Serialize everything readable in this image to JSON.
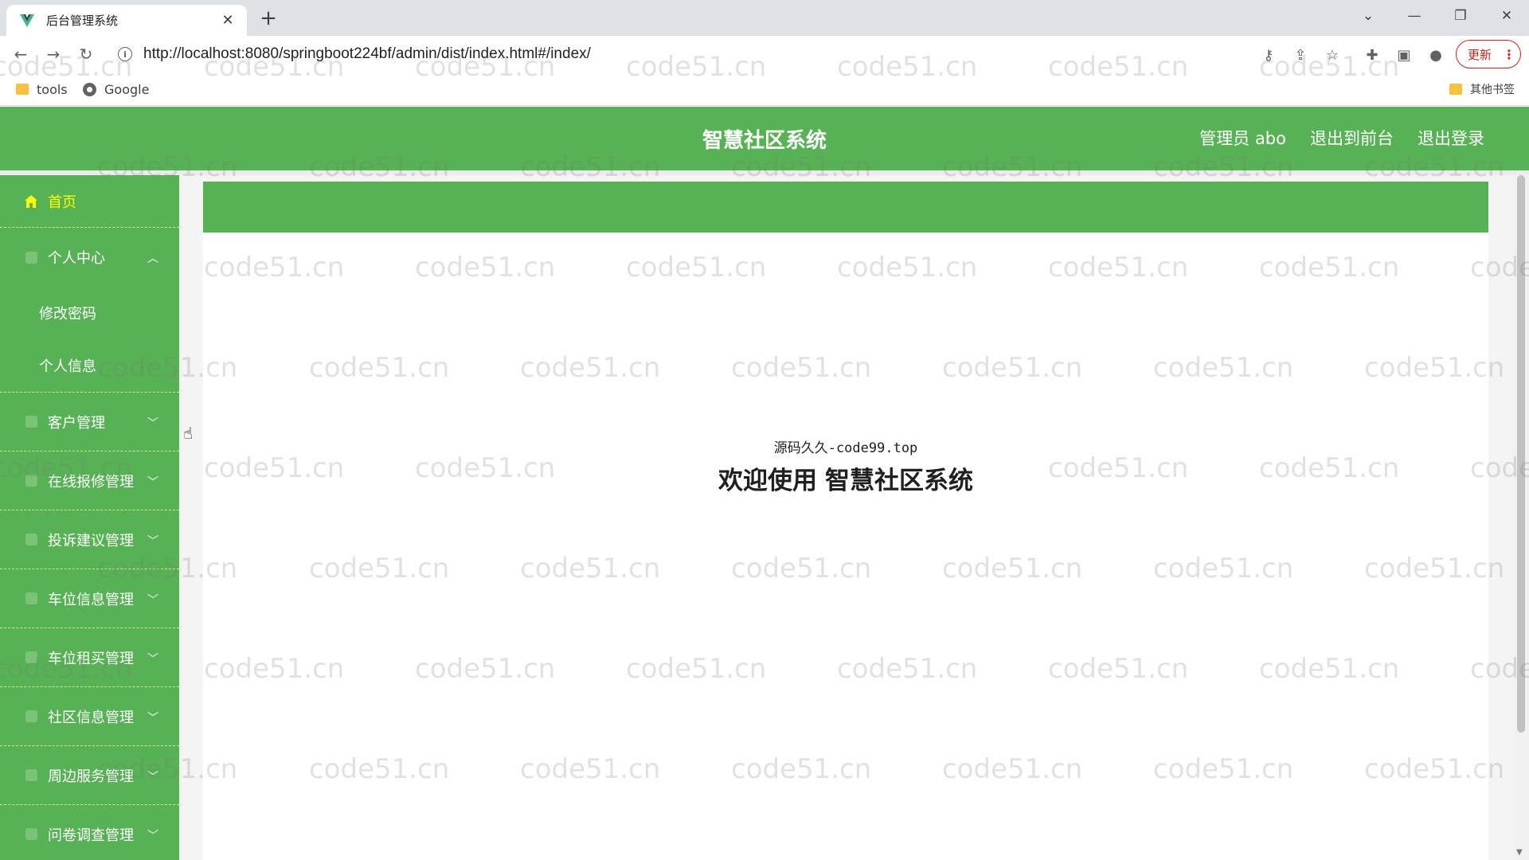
{
  "browser": {
    "tab_title": "后台管理系统",
    "tab_close": "✕",
    "new_tab": "+",
    "url": "http://localhost:8080/springboot224bf/admin/dist/index.html#/index/",
    "update_label": "更新",
    "bookmarks": [
      {
        "label": "tools",
        "icon": "folder-icon"
      },
      {
        "label": "Google",
        "icon": "globe-icon"
      }
    ],
    "other_bookmarks": "其他书签"
  },
  "app": {
    "title": "智慧社区系统",
    "header_links": [
      "管理员 abo",
      "退出到前台",
      "退出登录"
    ],
    "colors": {
      "primary": "#56b254",
      "active_menu": "#ffff00"
    }
  },
  "sidebar": {
    "home": "首页",
    "personal": {
      "label": "个人中心",
      "children": [
        "修改密码",
        "个人信息"
      ]
    },
    "items": [
      "客户管理",
      "在线报修管理",
      "投诉建议管理",
      "车位信息管理",
      "车位租买管理",
      "社区信息管理",
      "周边服务管理",
      "问卷调查管理"
    ]
  },
  "main": {
    "credit": "源码久久-code99.top",
    "welcome_prefix": "欢迎使用",
    "welcome_system": "智慧社区系统"
  },
  "watermark": "code51.cn"
}
